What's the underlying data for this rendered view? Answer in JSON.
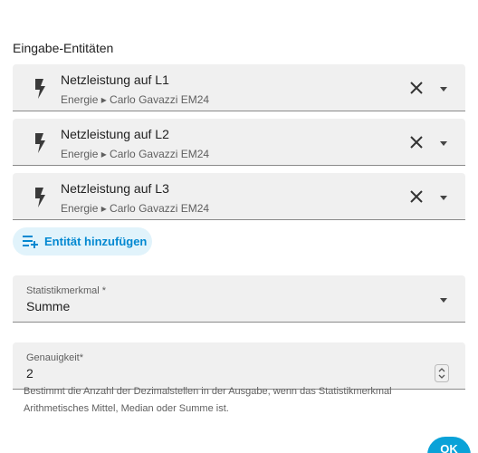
{
  "section_title": "Eingabe-Entitäten",
  "entities": [
    {
      "name": "Netzleistung auf L1",
      "subtitle": "Energie ▸ Carlo Gavazzi EM24",
      "icon": "flash-icon"
    },
    {
      "name": "Netzleistung auf L2",
      "subtitle": "Energie ▸ Carlo Gavazzi EM24",
      "icon": "flash-icon"
    },
    {
      "name": "Netzleistung auf L3",
      "subtitle": "Energie ▸ Carlo Gavazzi EM24",
      "icon": "flash-icon"
    }
  ],
  "add_entity_label": "Entität hinzufügen",
  "statistic": {
    "label": "Statistikmerkmal *",
    "value": "Summe"
  },
  "precision": {
    "label": "Genauigkeit*",
    "value": "2",
    "helper_line1": "Bestimmt die Anzahl der Dezimalstellen in der Ausgabe, wenn das Statistikmerkmal",
    "helper_line2": "Arithmetisches Mittel, Median oder Summe ist."
  },
  "ok_label": "OK",
  "colors": {
    "accent": "#0288d1",
    "button_bg": "#e1f3fb",
    "field_bg": "#f0f0f0",
    "ok_bg": "#0aa2d8"
  }
}
